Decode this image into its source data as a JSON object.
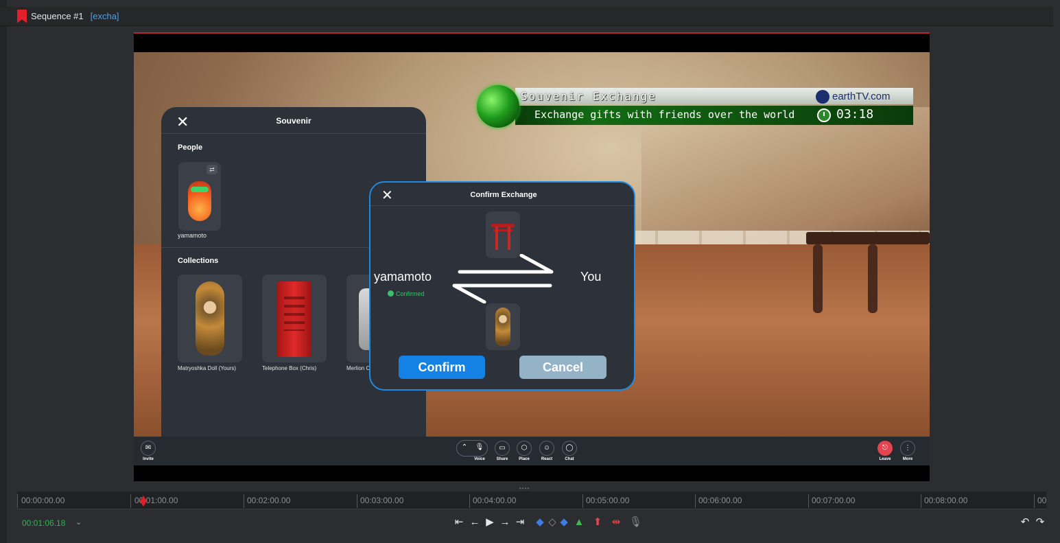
{
  "header": {
    "title": "Sequence #1",
    "tag": "[excha]"
  },
  "overlay": {
    "title": "Souvenir Exchange",
    "brand": "earthTV.com",
    "ticker": "Exchange gifts with friends over the world",
    "clock": "03:18"
  },
  "souvenir_panel": {
    "title": "Souvenir",
    "people_label": "People",
    "person_name": "yamamoto",
    "collections_label": "Collections",
    "collections": [
      {
        "name": "Matryoshka Doll (Yours)"
      },
      {
        "name": "Telephone Box (Chris)"
      },
      {
        "name": "Merlion C"
      }
    ]
  },
  "confirm_modal": {
    "title": "Confirm Exchange",
    "left_name": "yamamoto",
    "left_status": "Confirmed",
    "right_name": "You",
    "confirm_label": "Confirm",
    "cancel_label": "Cancel"
  },
  "callbar": {
    "invite": "Invite",
    "voice": "Voice",
    "share": "Share",
    "place": "Place",
    "react": "React",
    "chat": "Chat",
    "leave": "Leave",
    "more": "More"
  },
  "timeline": {
    "ticks": [
      "00:00:00.00",
      "00:01:00.00",
      "00:02:00.00",
      "00:03:00.00",
      "00:04:00.00",
      "00:05:00.00",
      "00:06:00.00",
      "00:07:00.00",
      "00:08:00.00",
      "00"
    ],
    "current_timecode": "00:01:06.18"
  },
  "colors": {
    "accent_blue": "#1481e5",
    "cancel_gray": "#94b3c6",
    "confirmed_green": "#39c26b",
    "timecode_green": "#2bb84c",
    "playhead_red": "#e01e2a"
  }
}
